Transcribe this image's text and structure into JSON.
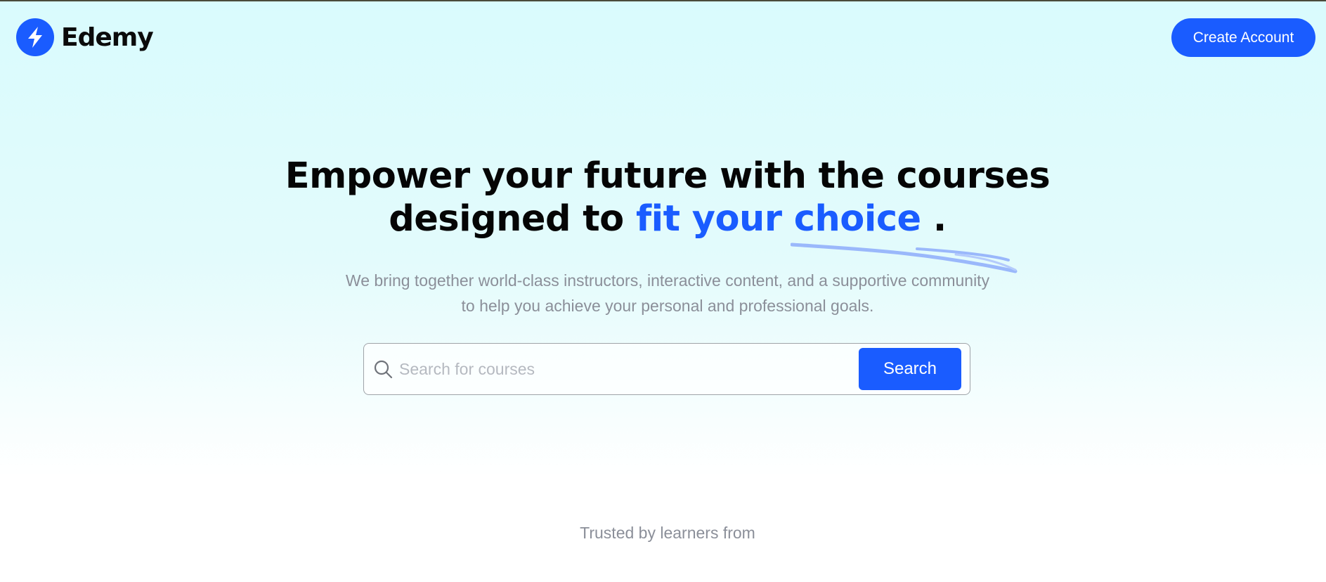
{
  "brand": {
    "name": "Edemy",
    "color": "#1a5cff"
  },
  "header": {
    "create_account_label": "Create Account"
  },
  "hero": {
    "title_part1": "Empower your future with the courses",
    "title_part2_prefix": "designed to ",
    "title_highlight": "fit your choice",
    "title_suffix": " .",
    "subtitle_line1": "We bring together world-class instructors, interactive content, and a supportive community",
    "subtitle_line2": "to help you achieve your personal and professional goals."
  },
  "search": {
    "placeholder": "Search for courses",
    "value": "",
    "button_label": "Search",
    "icon": "search-icon"
  },
  "trusted": {
    "label": "Trusted by learners from"
  }
}
